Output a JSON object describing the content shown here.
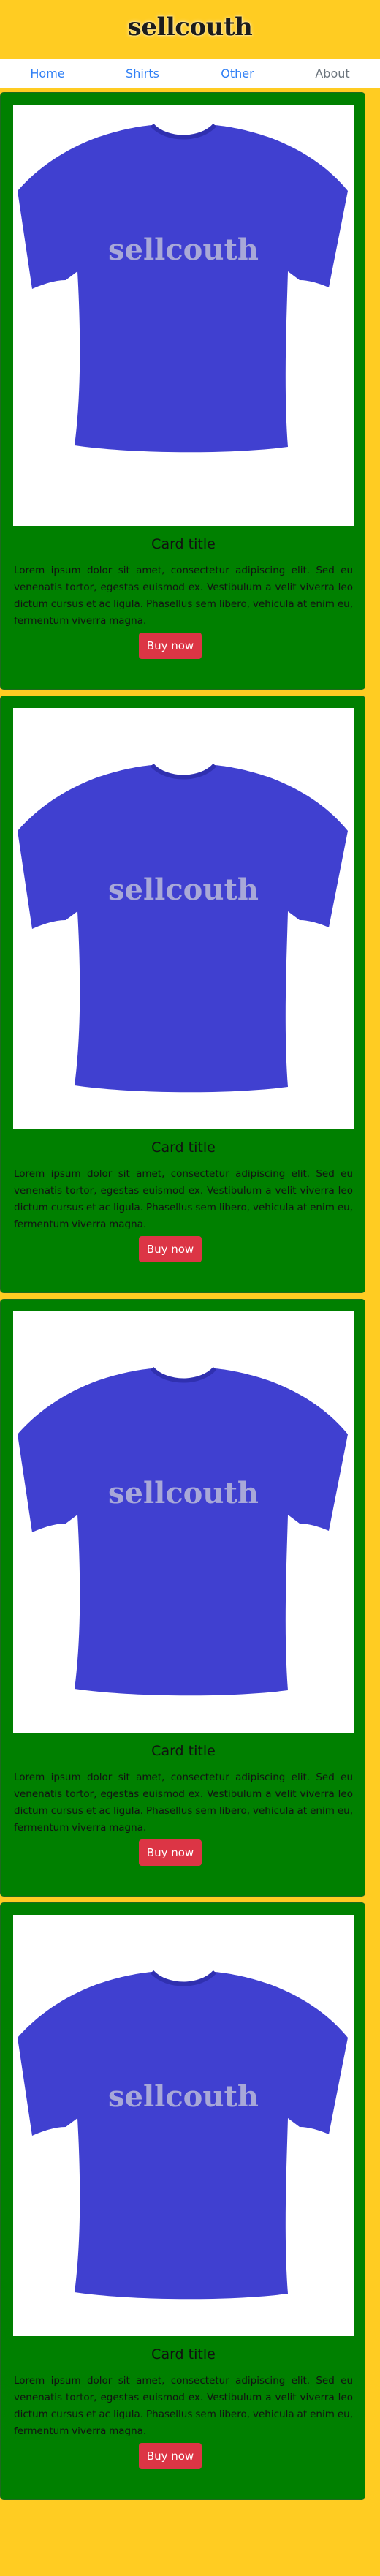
{
  "header": {
    "logo_text": "sellcouth"
  },
  "nav": {
    "items": [
      {
        "label": "Home"
      },
      {
        "label": "Shirts"
      },
      {
        "label": "Other"
      },
      {
        "label": "About"
      }
    ]
  },
  "colors": {
    "page_background": "#ffcc22",
    "card_background": "#008000",
    "button_background": "#dc3545",
    "nav_link": "#2f7ff5",
    "nav_link_muted": "#6c757d",
    "shirt": "#4040d0"
  },
  "product_image": {
    "shirt_print": "sellcouth"
  },
  "cards": [
    {
      "title": "Card title",
      "text": "Lorem ipsum dolor sit amet, consectetur adipiscing elit. Sed eu venenatis tortor, egestas euismod ex. Vestibulum a velit viverra leo dictum cursus et ac ligula. Phasellus sem libero, vehicula at enim eu, fermentum viverra magna.",
      "button_label": "Buy now"
    },
    {
      "title": "Card title",
      "text": "Lorem ipsum dolor sit amet, consectetur adipiscing elit. Sed eu venenatis tortor, egestas euismod ex. Vestibulum a velit viverra leo dictum cursus et ac ligula. Phasellus sem libero, vehicula at enim eu, fermentum viverra magna.",
      "button_label": "Buy now"
    },
    {
      "title": "Card title",
      "text": "Lorem ipsum dolor sit amet, consectetur adipiscing elit. Sed eu venenatis tortor, egestas euismod ex. Vestibulum a velit viverra leo dictum cursus et ac ligula. Phasellus sem libero, vehicula at enim eu, fermentum viverra magna.",
      "button_label": "Buy now"
    },
    {
      "title": "Card title",
      "text": "Lorem ipsum dolor sit amet, consectetur adipiscing elit. Sed eu venenatis tortor, egestas euismod ex. Vestibulum a velit viverra leo dictum cursus et ac ligula. Phasellus sem libero, vehicula at enim eu, fermentum viverra magna.",
      "button_label": "Buy now"
    }
  ]
}
